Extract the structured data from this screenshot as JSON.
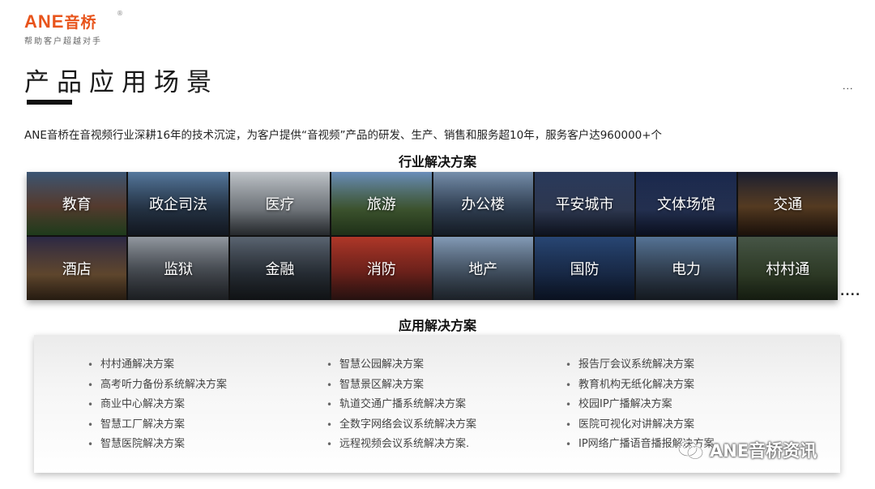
{
  "logo": {
    "brand": "ANE",
    "brand_cn": "音桥",
    "registered": "®",
    "slogan": "帮助客户超越对手"
  },
  "page_title": "产品应用场景",
  "title_trailing_dots": "...",
  "intro": "ANE音桥在音视频行业深耕16年的技术沉淀，为客户提供“音视频”产品的研发、生产、销售和服务超10年，服务客户达960000+个",
  "industry_section": {
    "title": "行业解决方案",
    "tiles": [
      "教育",
      "政企司法",
      "医疗",
      "旅游",
      "办公楼",
      "平安城市",
      "文体场馆",
      "交通",
      "酒店",
      "监狱",
      "金融",
      "消防",
      "地产",
      "国防",
      "电力",
      "村村通"
    ],
    "more": "...."
  },
  "application_section": {
    "title": "应用解决方案",
    "col1": [
      "村村通解决方案",
      "高考听力备份系统解决方案",
      "商业中心解决方案",
      "智慧工厂解决方案",
      "智慧医院解决方案"
    ],
    "col2": [
      "智慧公园解决方案",
      "智慧景区解决方案",
      "轨道交通广播系统解决方案",
      "全数字网络会议系统解决方案",
      "远程视频会议系统解决方案."
    ],
    "col3": [
      "报告厅会议系统解决方案",
      "教育机构无纸化解决方案",
      "校园IP广播解决方案",
      "医院可视化对讲解决方案",
      "IP网络广播语音播报解决方案"
    ]
  },
  "watermark": {
    "icon": "wechat-icon",
    "text": "ANE音桥资讯"
  },
  "colors": {
    "brand_orange": "#e8541b",
    "title_bar": "#111111"
  }
}
